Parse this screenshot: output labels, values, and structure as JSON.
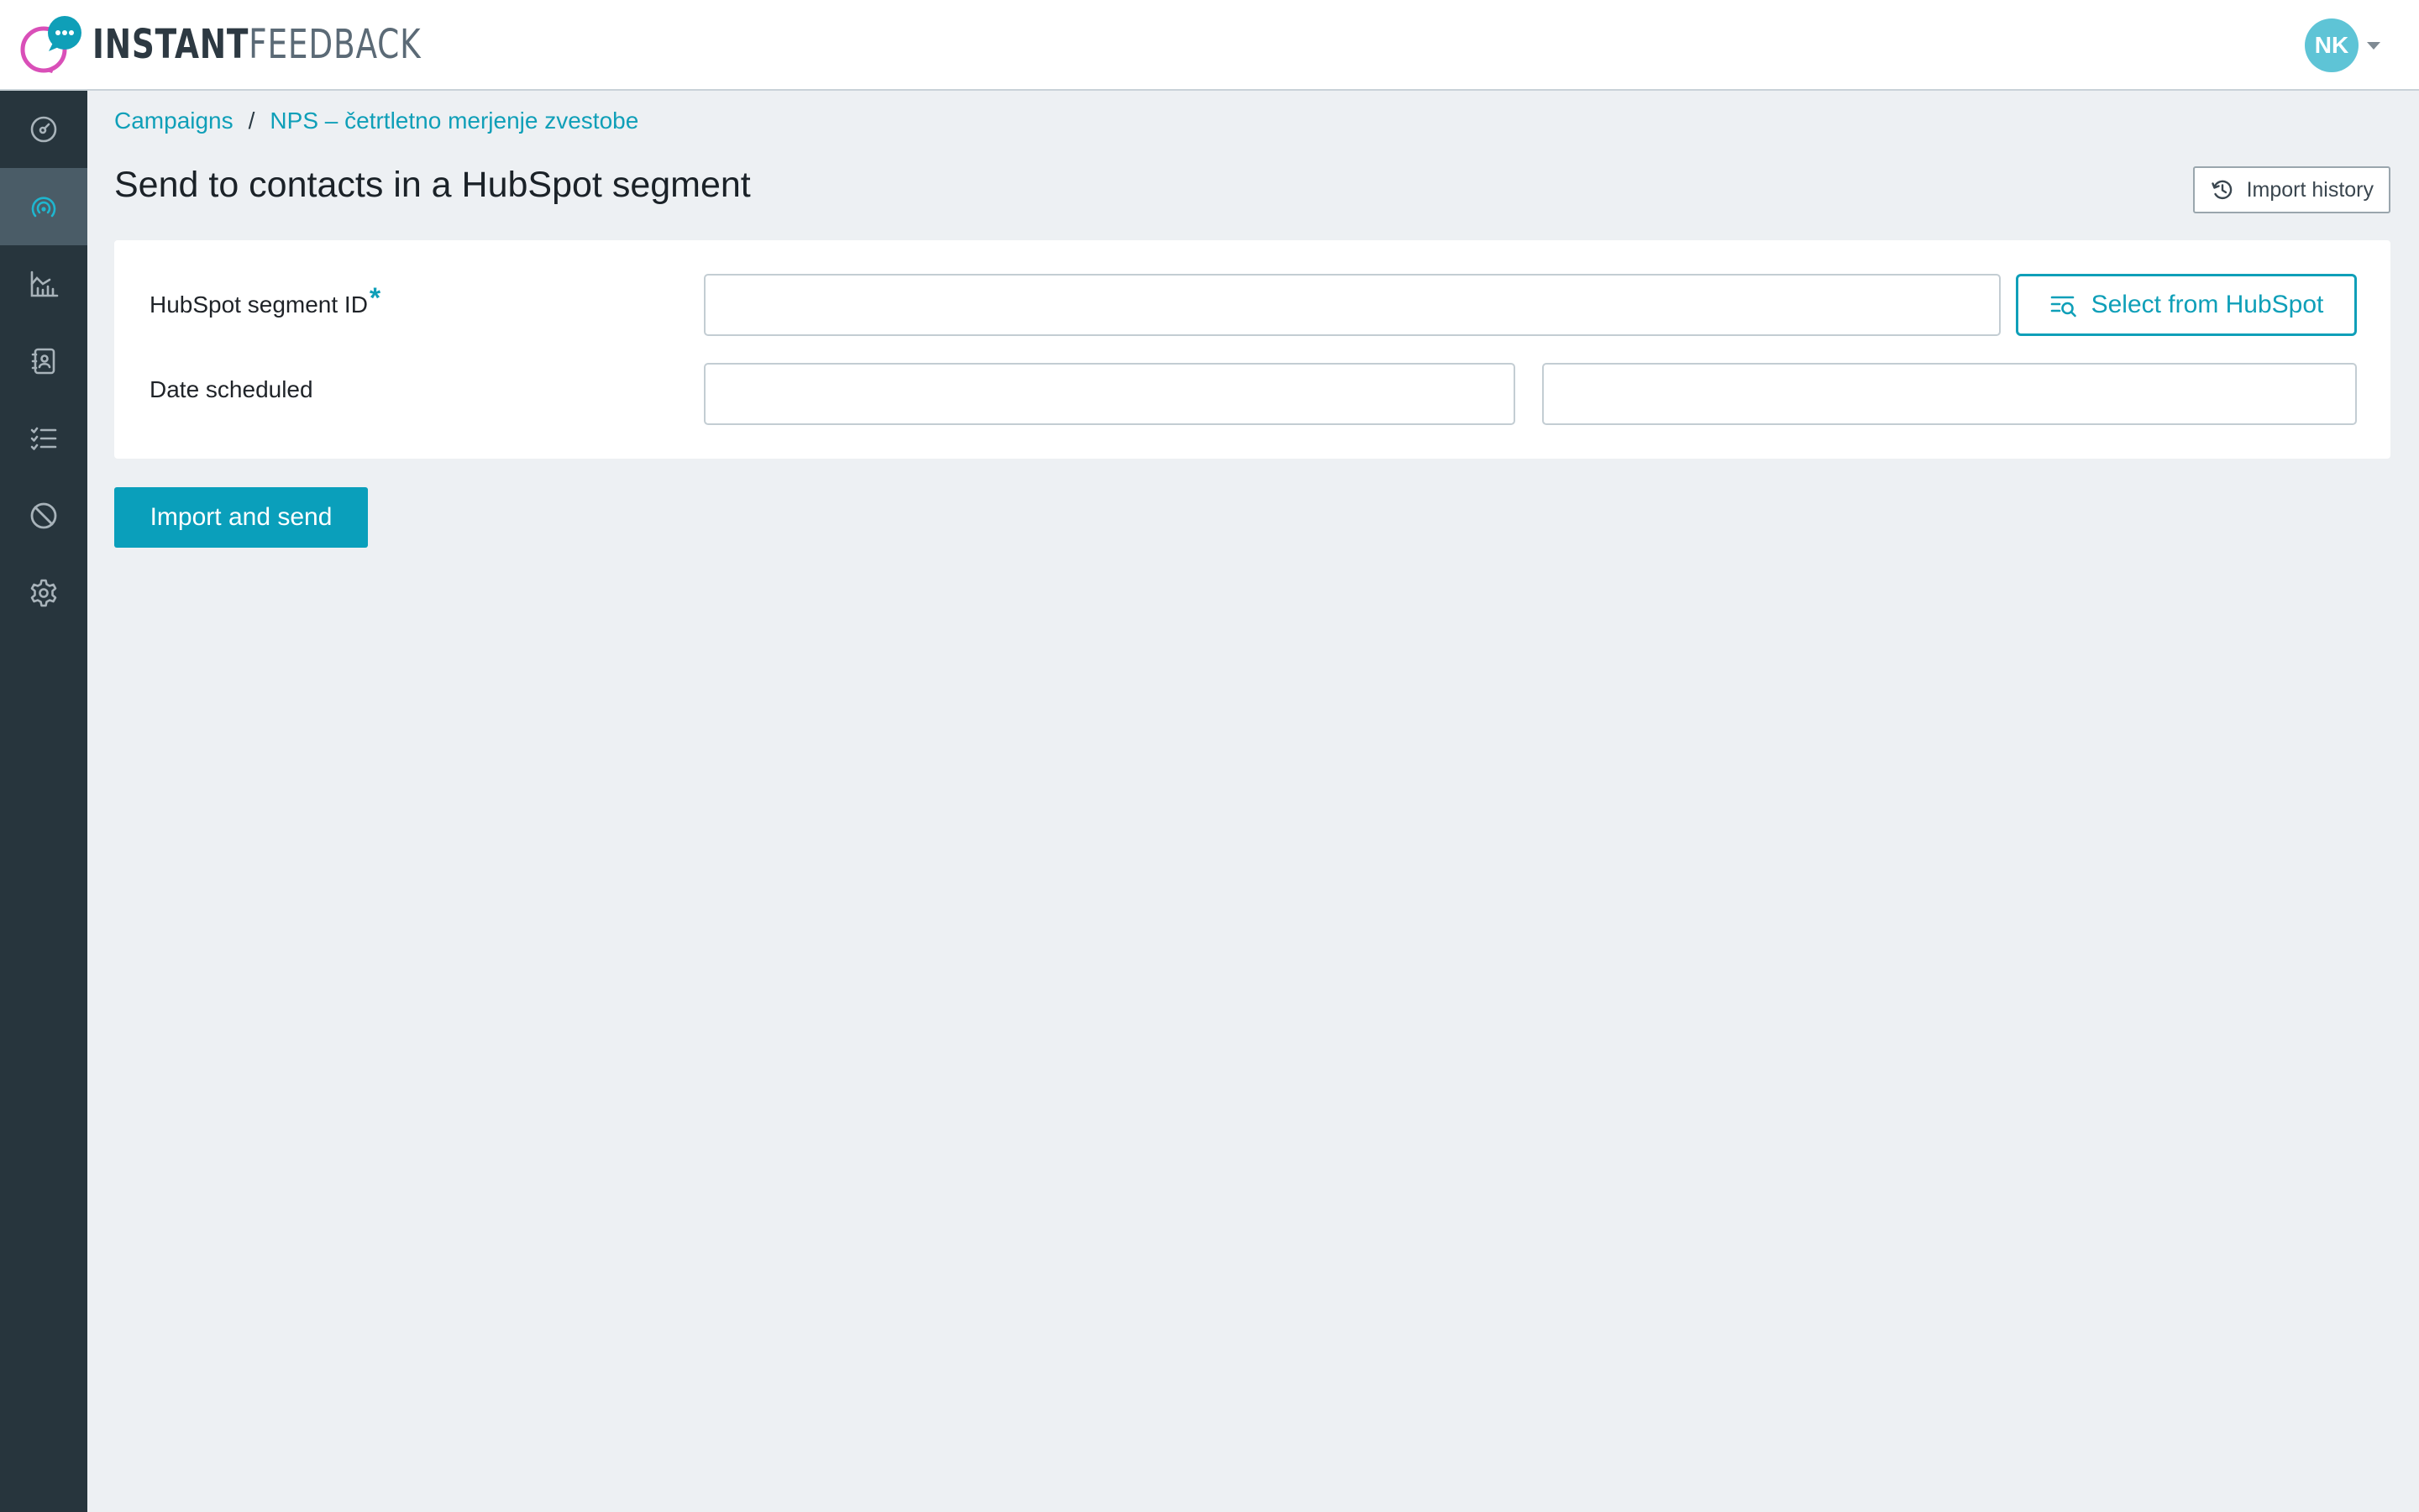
{
  "brand": {
    "name_strong": "INSTANT",
    "name_light": "FEEDBACK",
    "logo_ring_color": "#d94fb8",
    "logo_bubble_color": "#0f9fb8"
  },
  "user": {
    "initials": "NK",
    "avatar_color": "#5ec4d6"
  },
  "sidebar": {
    "items": [
      {
        "name": "dashboard",
        "icon": "speedometer-icon",
        "active": false
      },
      {
        "name": "campaigns",
        "icon": "broadcast-icon",
        "active": true
      },
      {
        "name": "analytics",
        "icon": "bar-chart-icon",
        "active": false
      },
      {
        "name": "contacts",
        "icon": "address-book-icon",
        "active": false
      },
      {
        "name": "tasks",
        "icon": "checklist-icon",
        "active": false
      },
      {
        "name": "blocked",
        "icon": "block-icon",
        "active": false
      },
      {
        "name": "settings",
        "icon": "gear-icon",
        "active": false
      }
    ],
    "icon_color": "#a8b3ba",
    "active_icon_color": "#1fb6cf"
  },
  "breadcrumb": {
    "items": [
      "Campaigns",
      "NPS – četrtletno merjenje zvestobe"
    ],
    "separator": "/"
  },
  "page": {
    "title": "Send to contacts in a HubSpot segment",
    "import_history_label": "Import history"
  },
  "form": {
    "segment_id": {
      "label": "HubSpot segment ID",
      "required_mark": "*",
      "value": ""
    },
    "select_button_label": "Select from HubSpot",
    "date_scheduled": {
      "label": "Date scheduled",
      "date_value": "",
      "time_value": ""
    },
    "submit_label": "Import and send"
  },
  "colors": {
    "accent": "#0f9fb8",
    "sidebar_bg": "#27353d",
    "sidebar_active_bg": "#4a5c67",
    "page_bg": "#edf0f3"
  }
}
